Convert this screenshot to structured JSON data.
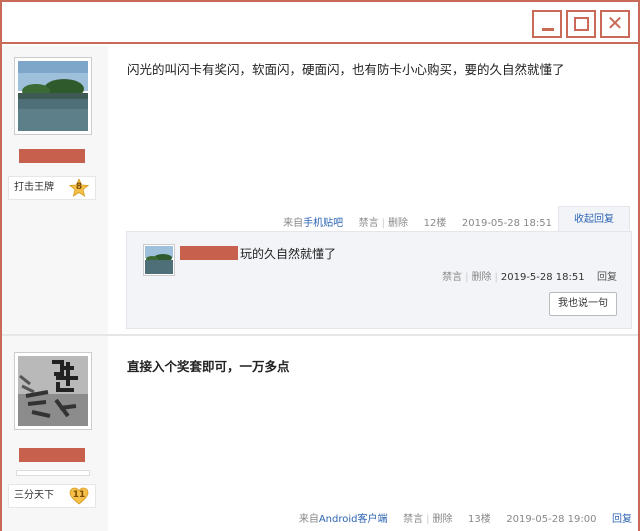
{
  "window": {
    "close_glyph": "✕",
    "accent": "#c96a58"
  },
  "posts": [
    {
      "level_name": "打击王牌",
      "level_num": "8",
      "content": "闪光的叫闪卡有奖闪，软面闪，硬面闪，也有防卡小心购买，要的久自然就懂了",
      "meta": {
        "source_prefix": "来自",
        "source_link": "手机贴吧",
        "ban": "禁言",
        "delete": "删除",
        "floor": "12楼",
        "time": "2019-05-28 18:51",
        "collapse": "收起回复"
      },
      "replies": [
        {
          "text": "玩的久自然就懂了",
          "ban": "禁言",
          "delete": "删除",
          "time": "2019-5-28 18:51",
          "reply": "回复"
        }
      ],
      "say_button": "我也说一句"
    },
    {
      "level_name": "三分天下",
      "level_num": "11",
      "content": "直接入个奖套即可，一万多点",
      "meta": {
        "source_prefix": "来自",
        "source_link": "Android客户端",
        "ban": "禁言",
        "delete": "删除",
        "floor": "13楼",
        "time": "2019-05-28 19:00",
        "reply": "回复"
      }
    }
  ],
  "colors": {
    "redaction": "#c8604e",
    "link": "#2d64b3"
  }
}
